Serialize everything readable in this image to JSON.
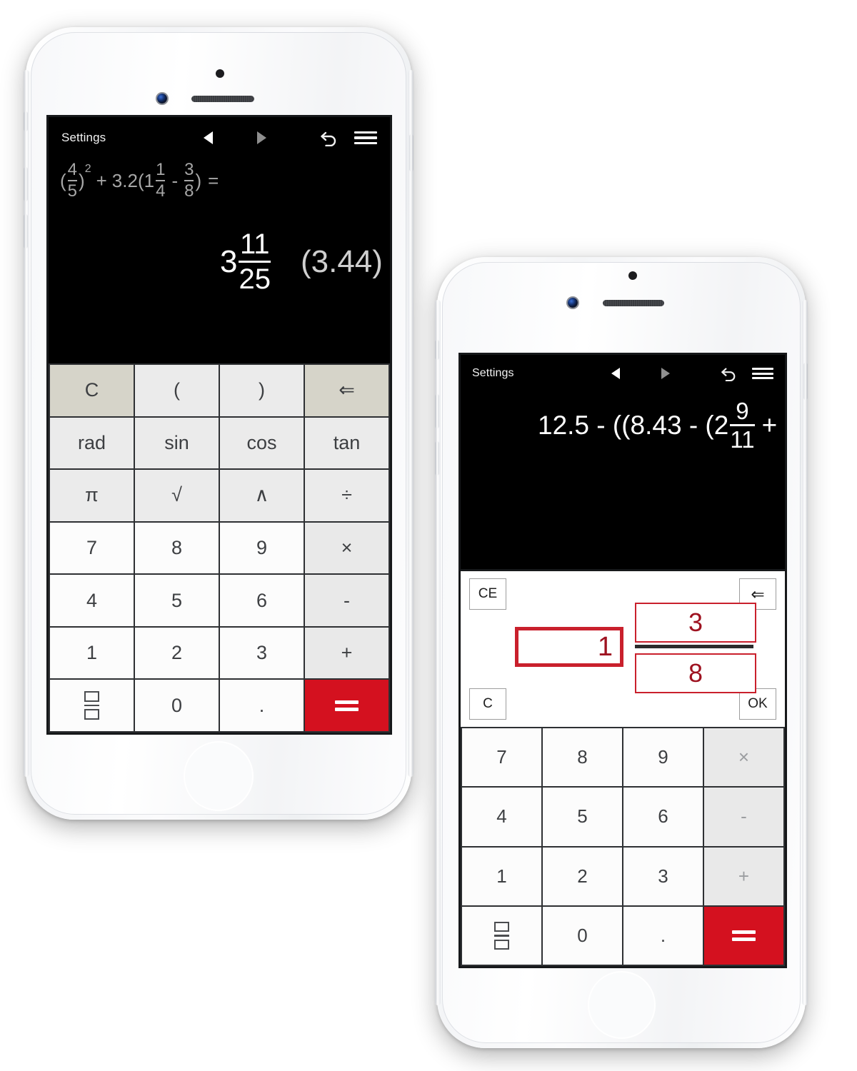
{
  "app": {
    "name": "Fraction Calculator",
    "accent_red": "#d4111f",
    "editor_red": "#c9202c",
    "key_tan": "#d6d4c9"
  },
  "phone1": {
    "toolbar": {
      "settings_label": "Settings",
      "prev_icon": "triangle-left-icon",
      "next_icon": "triangle-right-icon",
      "undo_icon": "undo-icon",
      "menu_icon": "hamburger-menu-icon"
    },
    "display": {
      "expression": {
        "full_text": "(4/5)² + 3.2(1 1/4 - 3/8) =",
        "open_paren": "(",
        "f1_num": "4",
        "f1_den": "5",
        "close_paren_sup": ")",
        "exponent": "2",
        "plus": "+",
        "coefficient": "3.2",
        "open_paren2": "(",
        "whole": "1",
        "f2_num": "1",
        "f2_den": "4",
        "minus": "-",
        "f3_num": "3",
        "f3_den": "8",
        "close_paren2": ")",
        "equals": "="
      },
      "result": {
        "full_text": "3 11/25 (3.44)",
        "whole": "3",
        "num": "11",
        "den": "25",
        "decimal": "(3.44)"
      }
    },
    "keypad": {
      "rows": [
        [
          {
            "label": "C",
            "name": "key-clear",
            "style": "tan"
          },
          {
            "label": "(",
            "name": "key-open-paren",
            "style": "lite"
          },
          {
            "label": ")",
            "name": "key-close-paren",
            "style": "lite"
          },
          {
            "label": "⇐",
            "name": "key-backspace",
            "style": "tan"
          }
        ],
        [
          {
            "label": "rad",
            "name": "key-rad",
            "style": "lite"
          },
          {
            "label": "sin",
            "name": "key-sin",
            "style": "lite"
          },
          {
            "label": "cos",
            "name": "key-cos",
            "style": "lite"
          },
          {
            "label": "tan",
            "name": "key-tan",
            "style": "lite"
          }
        ],
        [
          {
            "label": "π",
            "name": "key-pi",
            "style": "lite"
          },
          {
            "label": "√",
            "name": "key-sqrt",
            "style": "lite"
          },
          {
            "label": "∧",
            "name": "key-power",
            "style": "lite"
          },
          {
            "label": "÷",
            "name": "key-divide",
            "style": "lite"
          }
        ],
        [
          {
            "label": "7",
            "name": "key-7",
            "style": "num"
          },
          {
            "label": "8",
            "name": "key-8",
            "style": "num"
          },
          {
            "label": "9",
            "name": "key-9",
            "style": "num"
          },
          {
            "label": "×",
            "name": "key-multiply",
            "style": "op"
          }
        ],
        [
          {
            "label": "4",
            "name": "key-4",
            "style": "num"
          },
          {
            "label": "5",
            "name": "key-5",
            "style": "num"
          },
          {
            "label": "6",
            "name": "key-6",
            "style": "num"
          },
          {
            "label": "-",
            "name": "key-minus",
            "style": "op"
          }
        ],
        [
          {
            "label": "1",
            "name": "key-1",
            "style": "num"
          },
          {
            "label": "2",
            "name": "key-2",
            "style": "num"
          },
          {
            "label": "3",
            "name": "key-3",
            "style": "num"
          },
          {
            "label": "+",
            "name": "key-plus",
            "style": "op"
          }
        ],
        [
          {
            "label": "",
            "name": "key-fraction",
            "style": "num",
            "icon": "fraction-icon"
          },
          {
            "label": "0",
            "name": "key-0",
            "style": "num"
          },
          {
            "label": ".",
            "name": "key-decimal",
            "style": "num"
          },
          {
            "label": "=",
            "name": "key-equals",
            "style": "eq",
            "icon": "equals-icon"
          }
        ]
      ]
    }
  },
  "phone2": {
    "toolbar": {
      "settings_label": "Settings",
      "prev_icon": "triangle-left-icon",
      "next_icon": "triangle-right-icon",
      "undo_icon": "undo-icon",
      "menu_icon": "hamburger-menu-icon"
    },
    "display": {
      "expression": {
        "full_text": "12.5 - ((8.43 - (2 9/11 +",
        "lead": "12.5 - ((8.43 - (2",
        "num": "9",
        "den": "11",
        "trail": "+"
      }
    },
    "fraction_editor": {
      "ce_label": "CE",
      "c_label": "C",
      "ok_label": "OK",
      "backspace_icon": "backspace-arrow-icon",
      "whole_value": "1",
      "numerator_value": "3",
      "denominator_value": "8",
      "active_field": "whole"
    },
    "keypad": {
      "rows": [
        [
          {
            "label": "7",
            "name": "key-7",
            "style": "num"
          },
          {
            "label": "8",
            "name": "key-8",
            "style": "num"
          },
          {
            "label": "9",
            "name": "key-9",
            "style": "num"
          },
          {
            "label": "×",
            "name": "key-multiply",
            "style": "opdim"
          }
        ],
        [
          {
            "label": "4",
            "name": "key-4",
            "style": "num"
          },
          {
            "label": "5",
            "name": "key-5",
            "style": "num"
          },
          {
            "label": "6",
            "name": "key-6",
            "style": "num"
          },
          {
            "label": "-",
            "name": "key-minus",
            "style": "opdim"
          }
        ],
        [
          {
            "label": "1",
            "name": "key-1",
            "style": "num"
          },
          {
            "label": "2",
            "name": "key-2",
            "style": "num"
          },
          {
            "label": "3",
            "name": "key-3",
            "style": "num"
          },
          {
            "label": "+",
            "name": "key-plus",
            "style": "opdim"
          }
        ],
        [
          {
            "label": "",
            "name": "key-fraction",
            "style": "num",
            "icon": "fraction-icon"
          },
          {
            "label": "0",
            "name": "key-0",
            "style": "num"
          },
          {
            "label": ".",
            "name": "key-decimal",
            "style": "num"
          },
          {
            "label": "=",
            "name": "key-equals",
            "style": "eq",
            "icon": "equals-icon"
          }
        ]
      ]
    }
  }
}
